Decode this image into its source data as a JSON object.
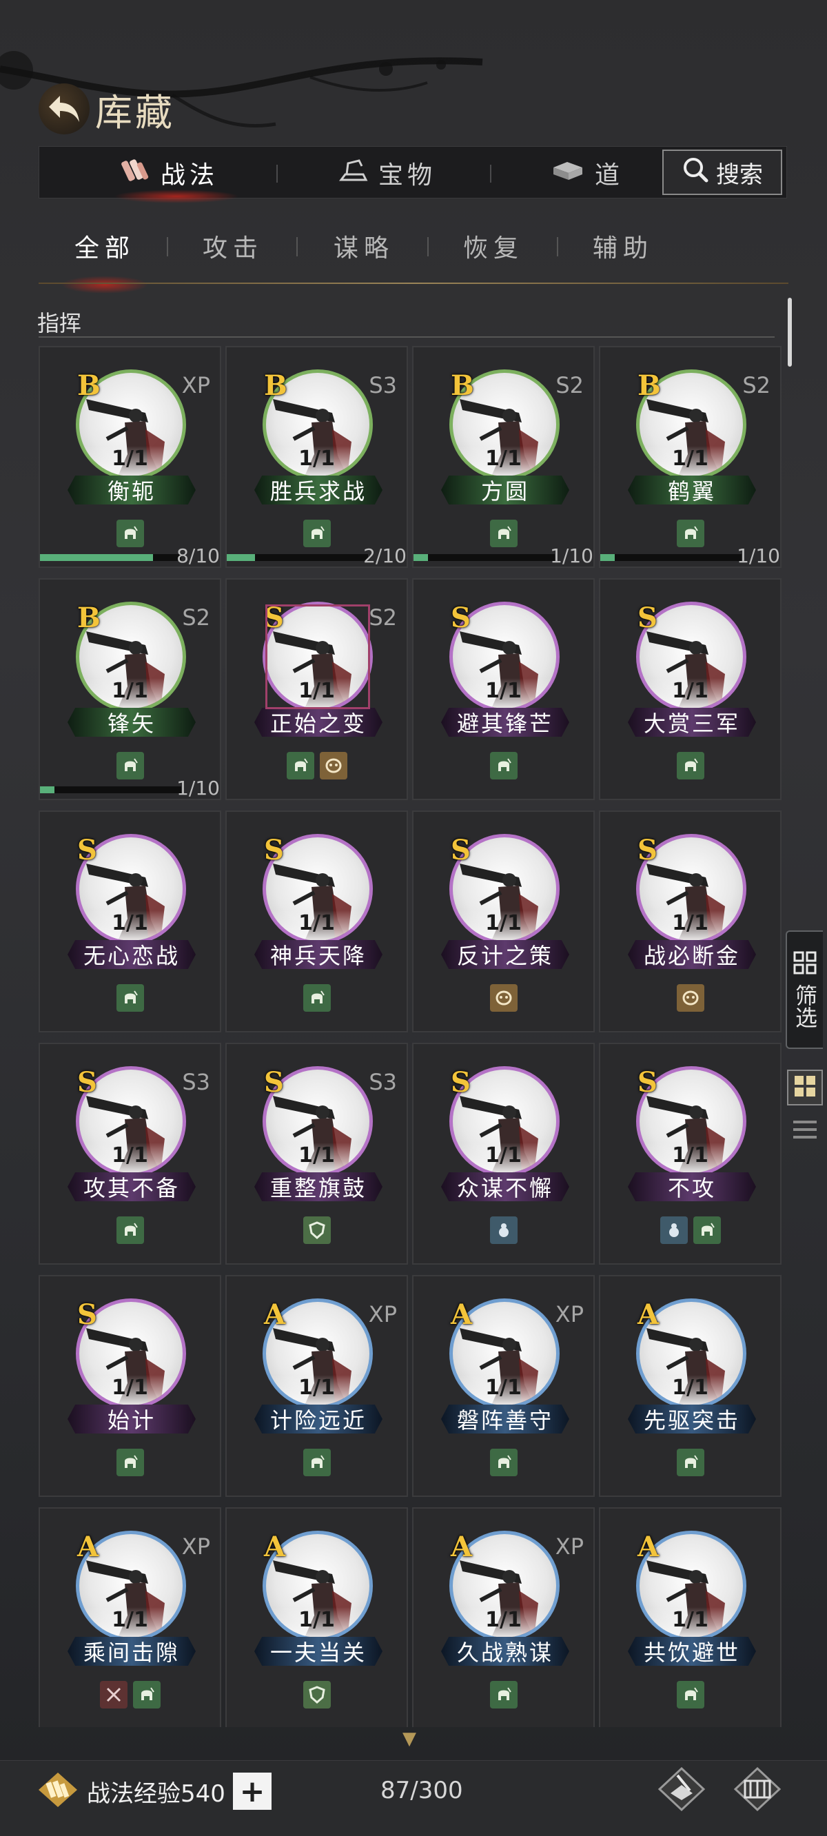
{
  "header": {
    "title": "库藏",
    "back_icon": "back-arrow-icon"
  },
  "tabs": [
    {
      "label": "战法",
      "icon": "scroll-bundle-icon",
      "active": true
    },
    {
      "label": "宝物",
      "icon": "treasure-icon",
      "active": false
    },
    {
      "label": "道",
      "icon": "item-icon",
      "active": false
    }
  ],
  "search": {
    "label": "搜索",
    "icon": "search-icon"
  },
  "subtabs": [
    {
      "label": "全部",
      "active": true
    },
    {
      "label": "攻击",
      "active": false
    },
    {
      "label": "谋略",
      "active": false
    },
    {
      "label": "恢复",
      "active": false
    },
    {
      "label": "辅助",
      "active": false
    }
  ],
  "section": {
    "title": "指挥"
  },
  "cards": [
    {
      "grade": "B",
      "name": "衡轭",
      "tag": "XP",
      "level": "1/1",
      "icons": [
        "helmet"
      ],
      "progress": {
        "value": 8,
        "max": 10,
        "text": "8/10"
      }
    },
    {
      "grade": "B",
      "name": "胜兵求战",
      "tag": "S3",
      "level": "1/1",
      "icons": [
        "helmet"
      ],
      "progress": {
        "value": 2,
        "max": 10,
        "text": "2/10"
      }
    },
    {
      "grade": "B",
      "name": "方圆",
      "tag": "S2",
      "level": "1/1",
      "icons": [
        "helmet"
      ],
      "progress": {
        "value": 1,
        "max": 10,
        "text": "1/10"
      }
    },
    {
      "grade": "B",
      "name": "鹤翼",
      "tag": "S2",
      "level": "1/1",
      "icons": [
        "helmet"
      ],
      "progress": {
        "value": 1,
        "max": 10,
        "text": "1/10"
      }
    },
    {
      "grade": "B",
      "name": "锋矢",
      "tag": "S2",
      "level": "1/1",
      "icons": [
        "helmet"
      ],
      "progress": {
        "value": 1,
        "max": 10,
        "text": "1/10"
      }
    },
    {
      "grade": "S",
      "name": "正始之变",
      "tag": "S2",
      "level": "1/1",
      "icons": [
        "helmet",
        "mask"
      ],
      "selected": true
    },
    {
      "grade": "S",
      "name": "避其锋芒",
      "tag": "",
      "level": "1/1",
      "icons": [
        "helmet"
      ]
    },
    {
      "grade": "S",
      "name": "大赏三军",
      "tag": "",
      "level": "1/1",
      "icons": [
        "helmet"
      ]
    },
    {
      "grade": "S",
      "name": "无心恋战",
      "tag": "",
      "level": "1/1",
      "icons": [
        "helmet"
      ]
    },
    {
      "grade": "S",
      "name": "神兵天降",
      "tag": "",
      "level": "1/1",
      "icons": [
        "helmet"
      ]
    },
    {
      "grade": "S",
      "name": "反计之策",
      "tag": "",
      "level": "1/1",
      "icons": [
        "mask"
      ]
    },
    {
      "grade": "S",
      "name": "战必断金",
      "tag": "",
      "level": "1/1",
      "icons": [
        "mask"
      ]
    },
    {
      "grade": "S",
      "name": "攻其不备",
      "tag": "S3",
      "level": "1/1",
      "icons": [
        "helmet"
      ]
    },
    {
      "grade": "S",
      "name": "重整旗鼓",
      "tag": "S3",
      "level": "1/1",
      "icons": [
        "shield"
      ]
    },
    {
      "grade": "S",
      "name": "众谋不懈",
      "tag": "",
      "level": "1/1",
      "icons": [
        "gourd"
      ]
    },
    {
      "grade": "S",
      "name": "不攻",
      "tag": "",
      "level": "1/1",
      "icons": [
        "gourd",
        "helmet"
      ]
    },
    {
      "grade": "S",
      "name": "始计",
      "tag": "",
      "level": "1/1",
      "icons": [
        "helmet"
      ]
    },
    {
      "grade": "A",
      "name": "计险远近",
      "tag": "XP",
      "level": "1/1",
      "icons": [
        "helmet"
      ]
    },
    {
      "grade": "A",
      "name": "磐阵善守",
      "tag": "XP",
      "level": "1/1",
      "icons": [
        "helmet"
      ]
    },
    {
      "grade": "A",
      "name": "先驱突击",
      "tag": "",
      "level": "1/1",
      "icons": [
        "helmet"
      ]
    },
    {
      "grade": "A",
      "name": "乘间击隙",
      "tag": "XP",
      "level": "1/1",
      "icons": [
        "cross",
        "helmet"
      ]
    },
    {
      "grade": "A",
      "name": "一夫当关",
      "tag": "",
      "level": "1/1",
      "icons": [
        "shield"
      ]
    },
    {
      "grade": "A",
      "name": "久战熟谋",
      "tag": "XP",
      "level": "1/1",
      "icons": [
        "helmet"
      ]
    },
    {
      "grade": "A",
      "name": "共饮避世",
      "tag": "",
      "level": "1/1",
      "icons": [
        "helmet"
      ]
    }
  ],
  "side": {
    "filter_label": "筛选"
  },
  "footer": {
    "xp_label": "战法经验540",
    "plus": "+",
    "count": "87/300"
  },
  "colors": {
    "grade_gold": "#f3c43a",
    "B": "#7cb05e",
    "S": "#b472c6",
    "A": "#6f9ed0",
    "progress": "#59b07a"
  }
}
